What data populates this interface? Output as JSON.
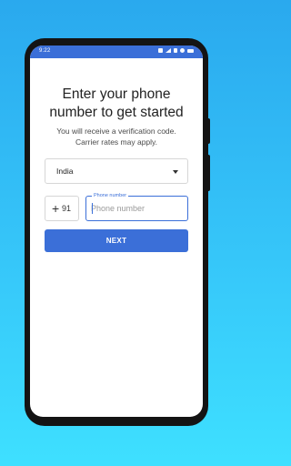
{
  "status_bar": {
    "time": "9:22",
    "icons": [
      "notification-icon",
      "signal-icon",
      "sim-icon",
      "alarm-icon",
      "battery-icon"
    ]
  },
  "heading": {
    "line1": "Enter your phone",
    "line2": "number to get started"
  },
  "subtext": {
    "line1": "You will receive a verification code.",
    "line2": "Carrier rates may apply."
  },
  "country_select": {
    "value": "India",
    "icon": "dropdown-caret-icon"
  },
  "country_code": {
    "plus": "+",
    "code": "91"
  },
  "phone_field": {
    "label": "Phone number",
    "placeholder": "Phone number",
    "value": ""
  },
  "next_button": {
    "label": "NEXT"
  },
  "colors": {
    "accent": "#3b6fd8",
    "background_top": "#2aa9ee",
    "background_bottom": "#3ee0ff",
    "phone_frame": "#141414"
  }
}
